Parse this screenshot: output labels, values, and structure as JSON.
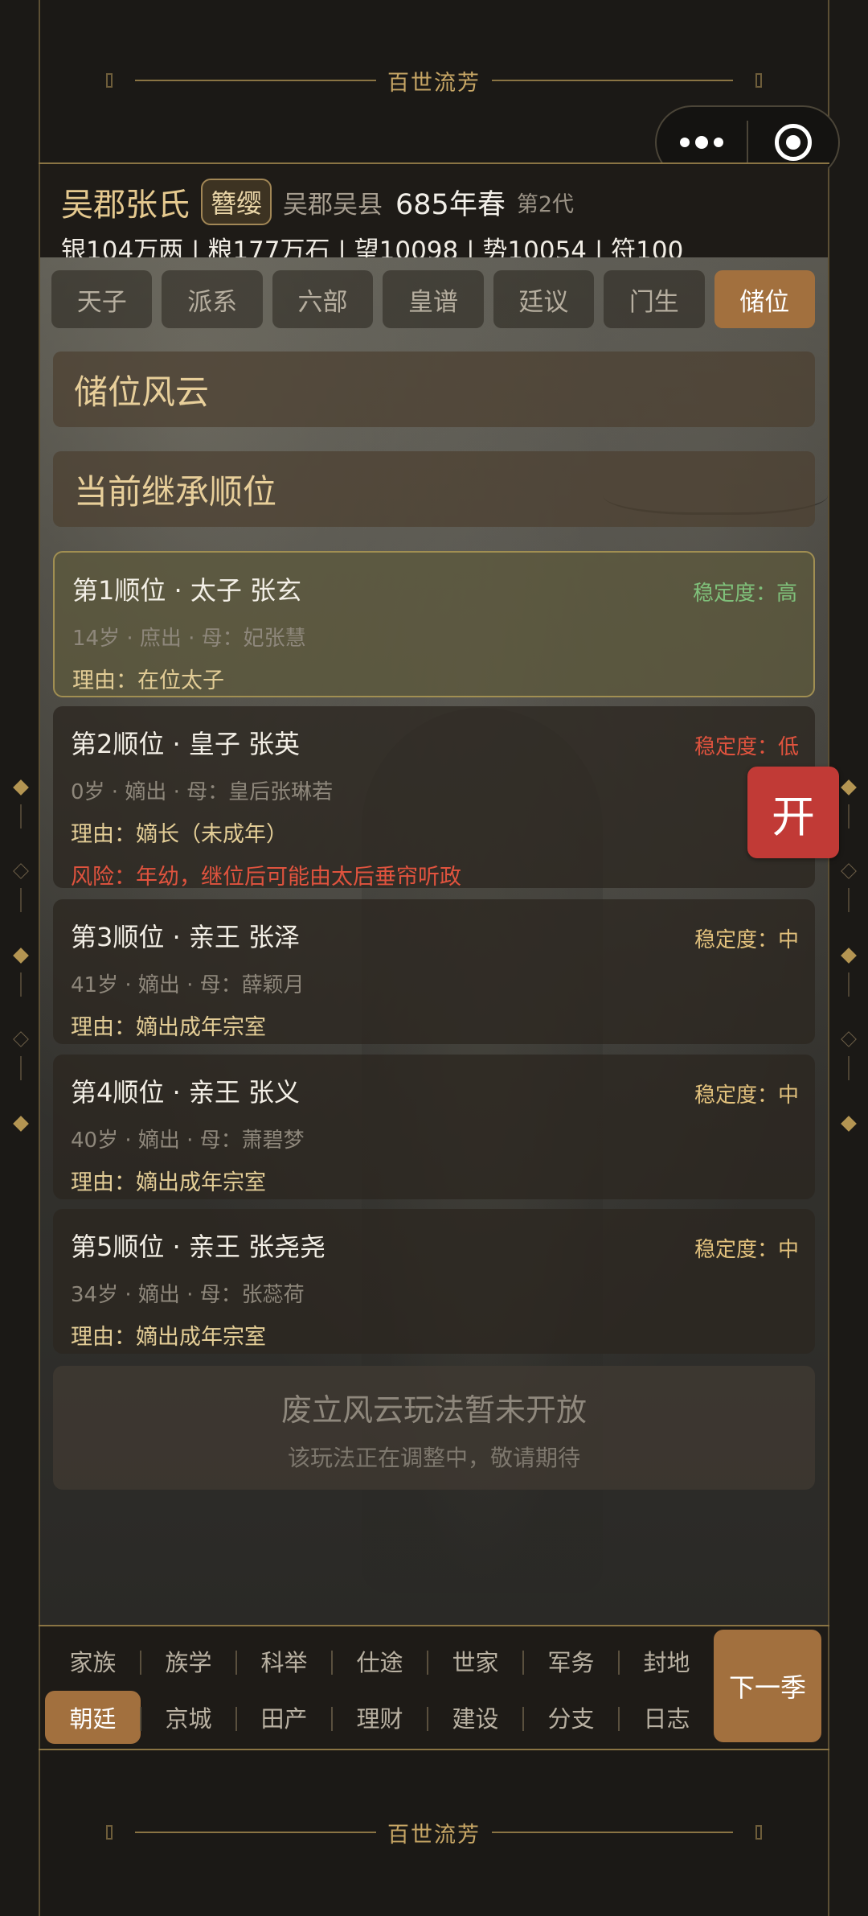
{
  "banner": {
    "title": "百世流芳"
  },
  "header": {
    "clan": "吴郡张氏",
    "badge": "簪缨",
    "place": "吴郡吴县",
    "year": "685年春",
    "generation": "第2代",
    "resources": "银104万两 | 粮177万石 | 望10098 | 势10054 | 符100"
  },
  "tabs": [
    {
      "label": "天子"
    },
    {
      "label": "派系"
    },
    {
      "label": "六部"
    },
    {
      "label": "皇谱"
    },
    {
      "label": "廷议"
    },
    {
      "label": "门生"
    },
    {
      "label": "储位",
      "active": true
    }
  ],
  "sections": {
    "title": "储位风云",
    "order_title": "当前继承顺位"
  },
  "heirs": [
    {
      "title": "第1顺位 · 太子 张玄",
      "stability": "稳定度：高",
      "stability_color": "#7fc07a",
      "info": "14岁 · 庶出 · 母：妃张慧",
      "reason": "理由：在位太子",
      "risk": ""
    },
    {
      "title": "第2顺位 · 皇子 张英",
      "stability": "稳定度：低",
      "stability_color": "#e0533e",
      "info": "0岁 · 嫡出 · 母：皇后张琳若",
      "reason": "理由：嫡长（未成年）",
      "risk": "风险：年幼，继位后可能由太后垂帘听政"
    },
    {
      "title": "第3顺位 · 亲王 张泽",
      "stability": "稳定度：中",
      "stability_color": "#e3c27d",
      "info": "41岁 · 嫡出 · 母：薛颖月",
      "reason": "理由：嫡出成年宗室",
      "risk": ""
    },
    {
      "title": "第4顺位 · 亲王 张义",
      "stability": "稳定度：中",
      "stability_color": "#e3c27d",
      "info": "40岁 · 嫡出 · 母：萧碧梦",
      "reason": "理由：嫡出成年宗室",
      "risk": ""
    },
    {
      "title": "第5顺位 · 亲王 张尧尧",
      "stability": "稳定度：中",
      "stability_color": "#e3c27d",
      "info": "34岁 · 嫡出 · 母：张蕊荷",
      "reason": "理由：嫡出成年宗室",
      "risk": ""
    }
  ],
  "notice": {
    "title": "废立风云玩法暂未开放",
    "subtitle": "该玩法正在调整中，敬请期待"
  },
  "open_button": "开",
  "nav": {
    "row1": [
      "家族",
      "族学",
      "科举",
      "仕途",
      "世家",
      "军务",
      "封地"
    ],
    "row2": [
      "朝廷",
      "京城",
      "田产",
      "理财",
      "建设",
      "分支",
      "日志"
    ],
    "active": "朝廷",
    "next_label": "下一季"
  },
  "colors": {
    "accent": "#a2703e",
    "gold": "#e8cf9a",
    "danger": "#c13a36"
  }
}
